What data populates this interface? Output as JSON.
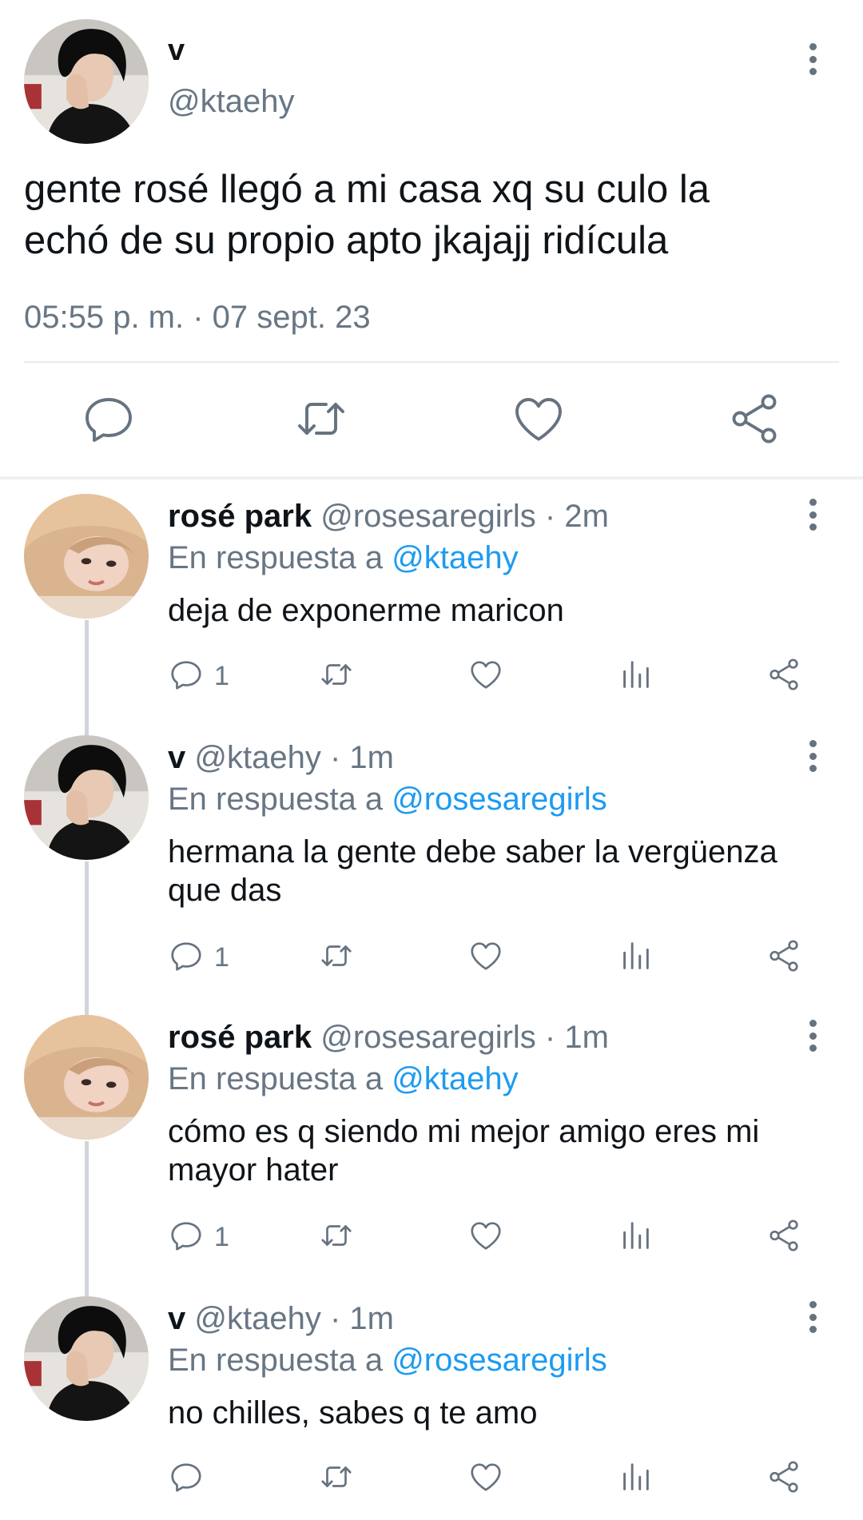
{
  "main_tweet": {
    "display_name": "v",
    "handle": "@ktaehy",
    "text_line1": "gente rosé llegó a mi casa xq su culo la",
    "text_line2": "echó de su propio apto jkajajj ridícula",
    "timestamp": "05:55 p. m. · 07 sept. 23"
  },
  "replies": [
    {
      "name": "rosé park",
      "meta": "@rosesaregirls · 2m",
      "in_reply_prefix": "En respuesta a",
      "in_reply_to": "@ktaehy",
      "text_line1": "deja de exponerme maricon",
      "text_line2": "",
      "reply_count": "1",
      "avatar": "rose"
    },
    {
      "name": "v",
      "meta": "@ktaehy · 1m",
      "in_reply_prefix": "En respuesta a",
      "in_reply_to": "@rosesaregirls",
      "text_line1": "hermana la gente debe saber la vergüenza",
      "text_line2": "que das",
      "reply_count": "1",
      "avatar": "v"
    },
    {
      "name": "rosé park",
      "meta": "@rosesaregirls · 1m",
      "in_reply_prefix": "En respuesta a",
      "in_reply_to": "@ktaehy",
      "text_line1": "cómo es q siendo mi mejor amigo eres mi",
      "text_line2": "mayor hater",
      "reply_count": "1",
      "avatar": "rose"
    },
    {
      "name": "v",
      "meta": "@ktaehy · 1m",
      "in_reply_prefix": "En respuesta a",
      "in_reply_to": "@rosesaregirls",
      "text_line1": "no chilles, sabes q te amo",
      "text_line2": "",
      "reply_count": "",
      "avatar": "v"
    }
  ],
  "colors": {
    "text": "#0f1419",
    "secondary": "#687684",
    "mention": "#1d9bf0",
    "icon": "#66727f",
    "divider": "#e6ecf0"
  }
}
